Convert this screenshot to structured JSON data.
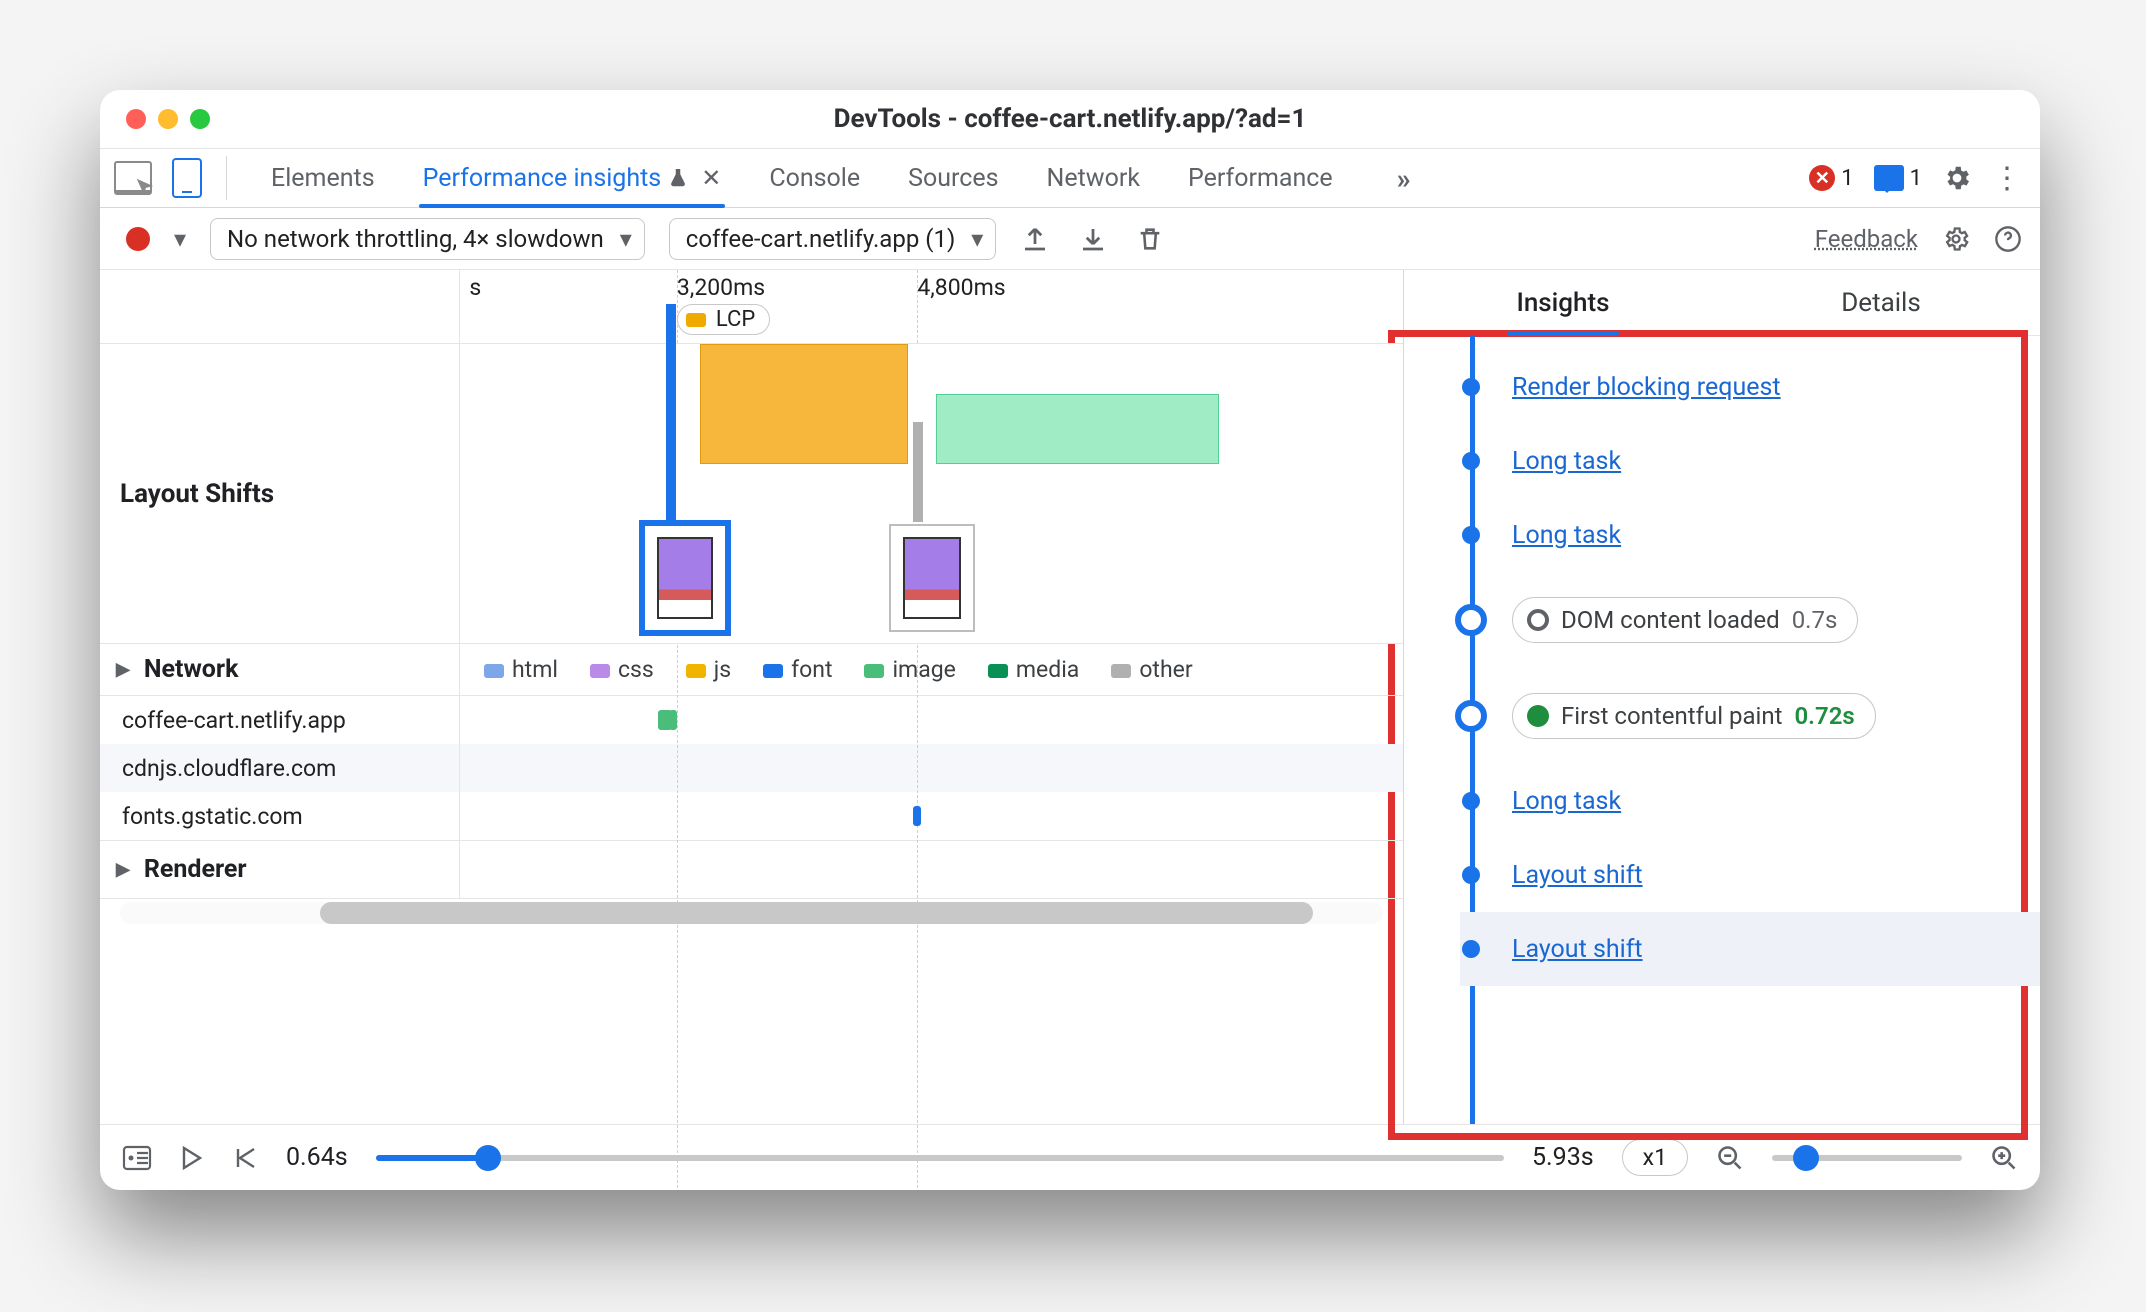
{
  "window": {
    "title": "DevTools - coffee-cart.netlify.app/?ad=1"
  },
  "tabs": {
    "items": [
      "Elements",
      "Performance insights",
      "Console",
      "Sources",
      "Network",
      "Performance"
    ],
    "active_index": 1,
    "more_glyph": "»",
    "errors_count": "1",
    "messages_count": "1"
  },
  "toolbar": {
    "throttling": "No network throttling, 4× slowdown",
    "target": "coffee-cart.netlify.app (1)",
    "feedback": "Feedback"
  },
  "ruler": {
    "ticks": [
      {
        "label": "s",
        "pos_pct": 1
      },
      {
        "label": "3,200ms",
        "pos_pct": 23
      },
      {
        "label": "4,800ms",
        "pos_pct": 48.5
      }
    ],
    "lcp_label": "LCP",
    "lcp_pos_pct": 23
  },
  "layout_shifts_label": "Layout Shifts",
  "legend": {
    "network_label": "Network",
    "items": [
      {
        "key": "html",
        "label": "html"
      },
      {
        "key": "css",
        "label": "css"
      },
      {
        "key": "js",
        "label": "js"
      },
      {
        "key": "font",
        "label": "font"
      },
      {
        "key": "image",
        "label": "image"
      },
      {
        "key": "media",
        "label": "media"
      },
      {
        "key": "other",
        "label": "other"
      }
    ]
  },
  "network_rows": [
    {
      "host": "coffee-cart.netlify.app"
    },
    {
      "host": "cdnjs.cloudflare.com"
    },
    {
      "host": "fonts.gstatic.com"
    }
  ],
  "renderer_label": "Renderer",
  "bottom": {
    "start": "0.64s",
    "end": "5.93s",
    "zoom_label": "x1"
  },
  "right_panel": {
    "tabs": [
      "Insights",
      "Details"
    ],
    "active": 0,
    "items": [
      {
        "type": "link",
        "text": "Render blocking request"
      },
      {
        "type": "link",
        "text": "Long task"
      },
      {
        "type": "link",
        "text": "Long task"
      },
      {
        "type": "event",
        "label": "DOM content loaded",
        "value": "0.7s",
        "value_class": ""
      },
      {
        "type": "event",
        "label": "First contentful paint",
        "value": "0.72s",
        "value_class": "green"
      },
      {
        "type": "link",
        "text": "Long task"
      },
      {
        "type": "link",
        "text": "Layout shift"
      },
      {
        "type": "link",
        "text": "Layout shift",
        "highlight": true
      }
    ]
  }
}
